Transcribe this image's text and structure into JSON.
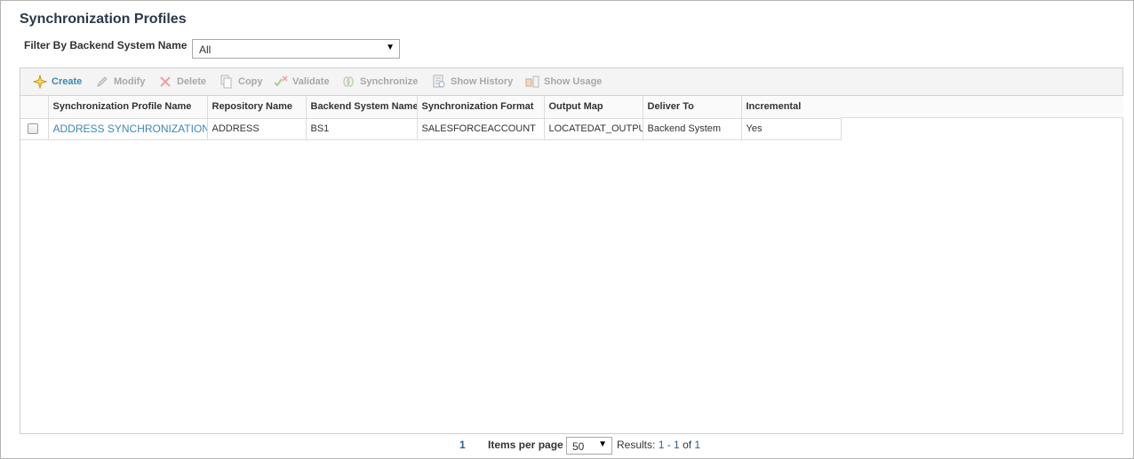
{
  "page": {
    "title": "Synchronization Profiles"
  },
  "filter": {
    "label": "Filter By Backend System Name",
    "selected": "All"
  },
  "toolbar": {
    "create": "Create",
    "modify": "Modify",
    "delete": "Delete",
    "copy": "Copy",
    "validate": "Validate",
    "synchronize": "Synchronize",
    "show_history": "Show History",
    "show_usage": "Show Usage"
  },
  "grid": {
    "columns": [
      "Synchronization Profile Name",
      "Repository Name",
      "Backend System Name",
      "Synchronization Format",
      "Output Map",
      "Deliver To",
      "Incremental"
    ],
    "rows": [
      {
        "checked": false,
        "profile_name": "ADDRESS SYNCHRONIZATION",
        "repository": "ADDRESS",
        "backend": "BS1",
        "format": "SALESFORCEACCOUNT",
        "output_map": "LOCATEDAT_OUTPUT",
        "deliver_to": "Backend System",
        "incremental": "Yes"
      }
    ]
  },
  "pager": {
    "current_page": "1",
    "items_per_page_label": "Items per page",
    "items_per_page": "50",
    "results_label": "Results:",
    "results_range": "1 - 1",
    "results_of": "of",
    "results_total": "1"
  },
  "colors": {
    "link": "#3d87b8",
    "title": "#2a3a4a",
    "disabled": "#a8a8a8"
  }
}
